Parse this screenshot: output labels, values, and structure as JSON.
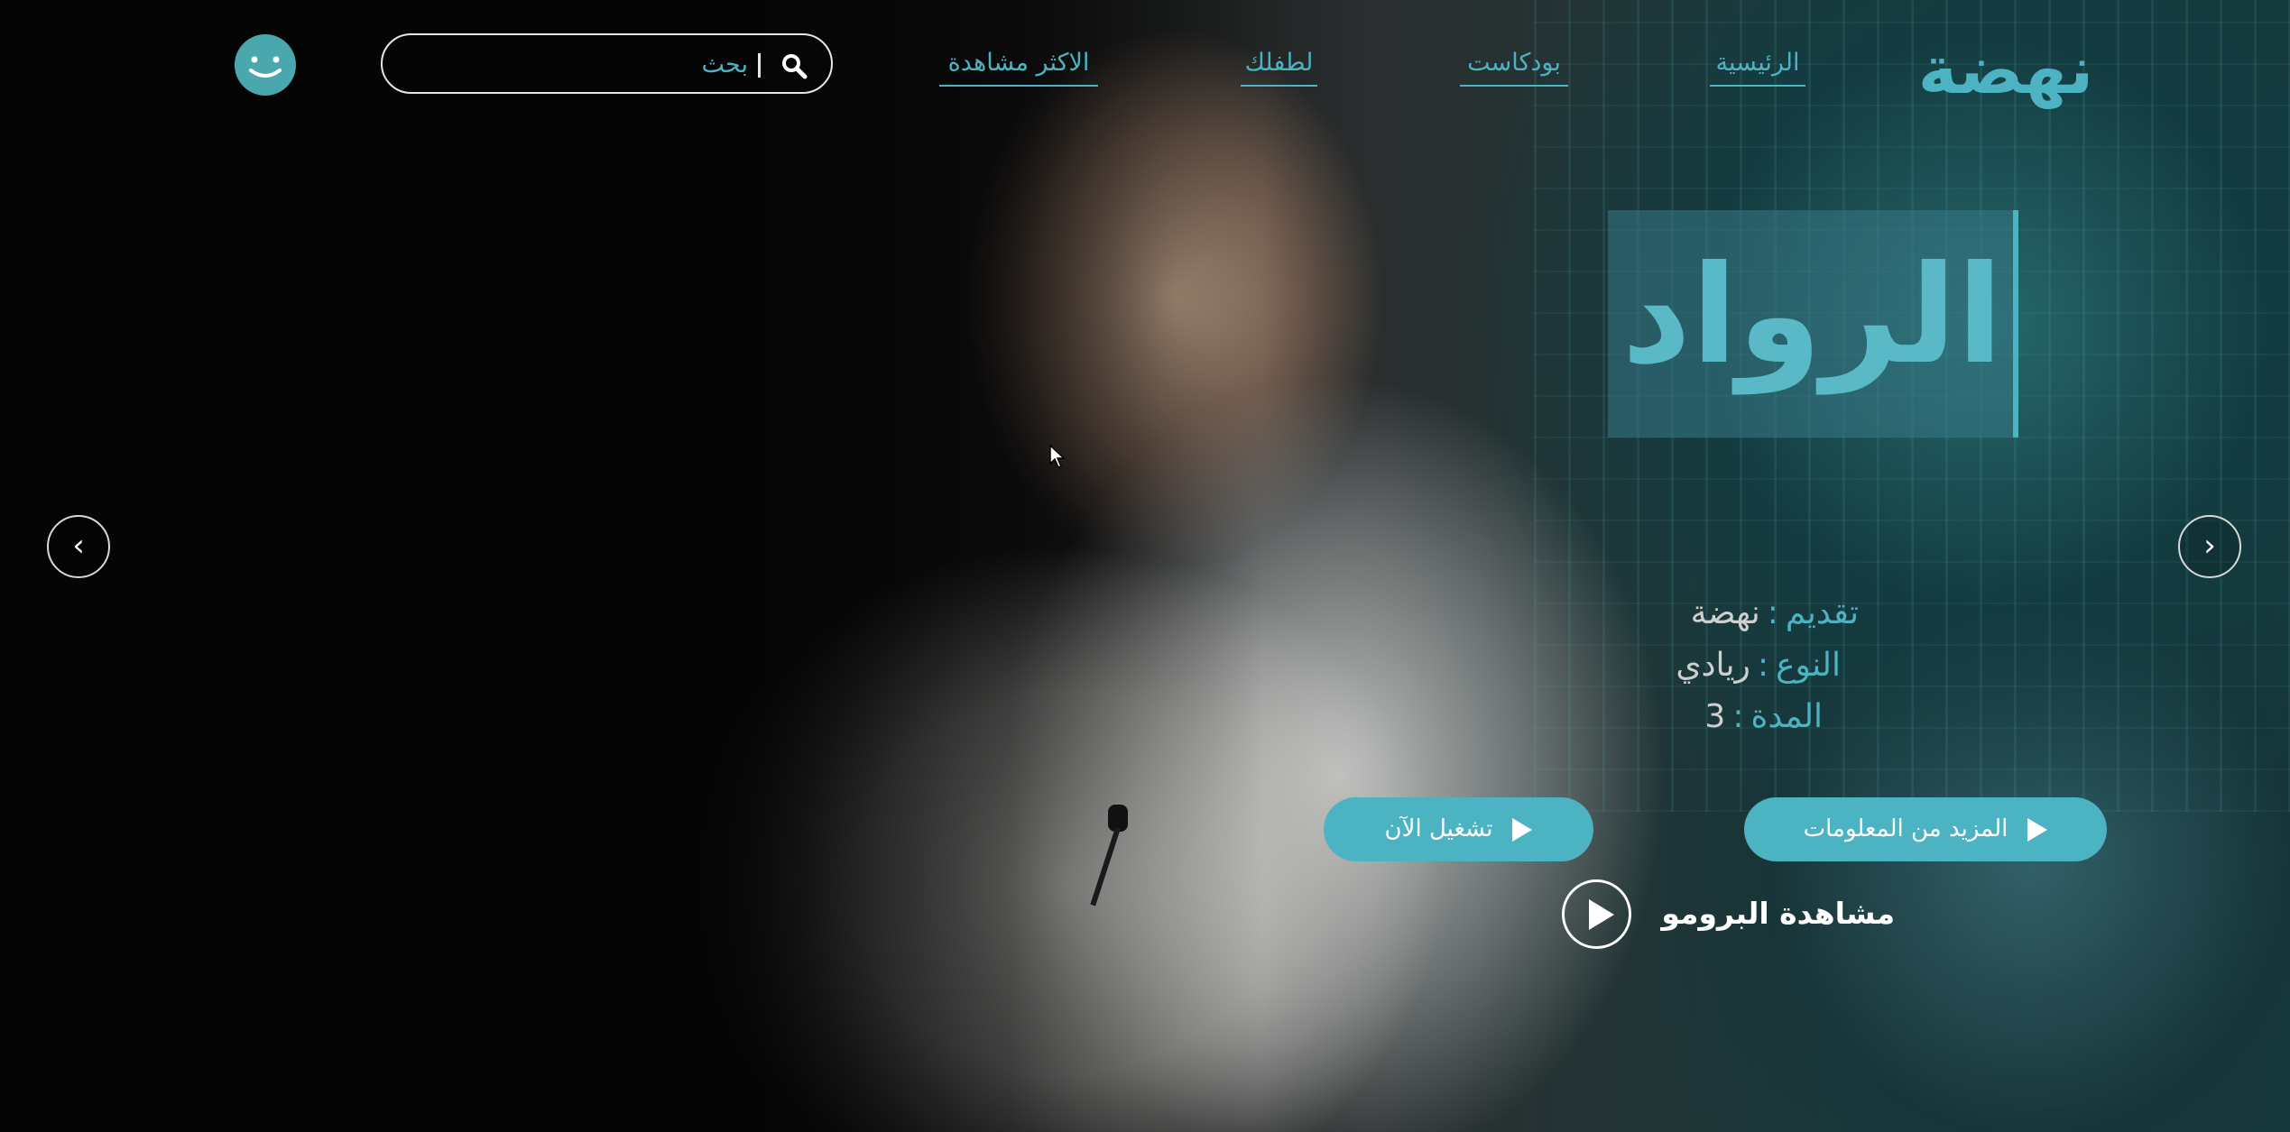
{
  "brand": {
    "logo_text": "نهضة"
  },
  "nav": [
    {
      "label": "الرئيسية"
    },
    {
      "label": "بودكاست"
    },
    {
      "label": "لطفلك"
    },
    {
      "label": "الاكثر مشاهدة"
    }
  ],
  "search": {
    "placeholder": "بحث"
  },
  "hero": {
    "title": "الرواد",
    "meta": [
      {
        "key": "تقديم",
        "value": "نهضة"
      },
      {
        "key": "النوع",
        "value": "ريادي"
      },
      {
        "key": "المدة",
        "value": "3"
      }
    ],
    "meta_separator": ":",
    "more_info_label": "المزيد من المعلومات",
    "play_now_label": "تشغيل الآن",
    "promo_label": "مشاهدة البرومو"
  },
  "carousel": {
    "prev_icon": "‹",
    "next_icon": "›"
  },
  "colors": {
    "accent": "#4bb3c2",
    "avatar": "#4aa7ae",
    "background": "#050505"
  },
  "icons": [
    "search-icon",
    "smiley-avatar-icon",
    "play-icon",
    "chevron-left-icon",
    "chevron-right-icon"
  ]
}
